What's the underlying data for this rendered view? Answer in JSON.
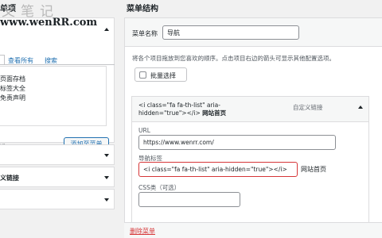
{
  "watermark": {
    "text": "文笔记",
    "url": "www.wenRR.com"
  },
  "left": {
    "header": "单项",
    "tabs": [
      "查看所有",
      "搜索"
    ],
    "items": [
      "页面存档",
      "标签大全",
      "免责声明"
    ],
    "select_all": "选",
    "add_button": "添加至菜单",
    "sections": [
      "",
      "义链接",
      ""
    ]
  },
  "right": {
    "header": "菜单结构",
    "menu_name_label": "菜单名称",
    "menu_name_value": "导航",
    "instructions": "将各个项目拖放到您喜欢的顺序。点击项目右边的箭头可显示其他配置选项。",
    "bulk_select": "批量选择",
    "item": {
      "title_code": "<i class=\"fa fa-th-list\" aria-hidden=\"true\"></i>",
      "title_text": "网站首页",
      "type": "自定义链接",
      "url_label": "URL",
      "url_value": "https://www.wenrr.com/",
      "nav_label": "导航标签",
      "nav_value": "<i class=\"fa fa-th-list\" aria-hidden=\"true\"></i>",
      "nav_suffix": "网站首页",
      "css_label": "CSS类（可选）"
    },
    "delete_link": "删除菜单"
  },
  "colors": {
    "accent": "#2271b1",
    "danger": "#d63638"
  }
}
